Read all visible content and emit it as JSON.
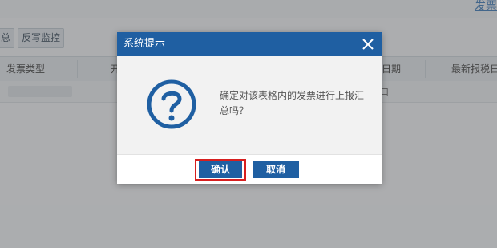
{
  "background": {
    "top_link": "发票",
    "toolbar": {
      "partial_button": "总",
      "reverse_monitor_button": "反写监控"
    },
    "table": {
      "headers": [
        "发票类型",
        "开",
        "日期",
        "最新报税日"
      ],
      "row_fragment": "口"
    }
  },
  "dialog": {
    "title": "系统提示",
    "message": "确定对该表格内的发票进行上报汇总吗？",
    "confirm_label": "确认",
    "cancel_label": "取消"
  },
  "colors": {
    "header_blue": "#1f5fa2",
    "highlight_red": "#d71f1f"
  },
  "icons": {
    "close": "close-icon",
    "question": "question-icon"
  }
}
